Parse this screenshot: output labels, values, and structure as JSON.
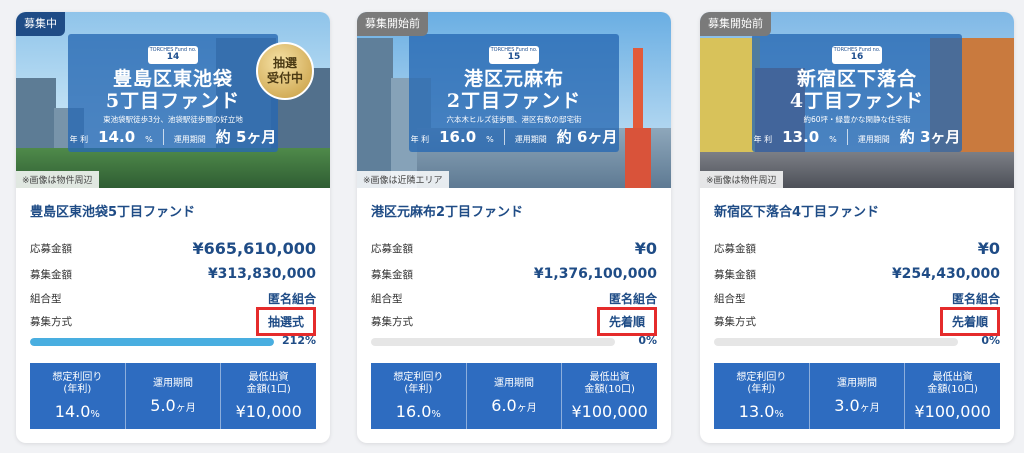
{
  "cards": [
    {
      "status": "募集中",
      "photo_note": "※画像は物件周辺",
      "lottery_badge_line1": "抽選",
      "lottery_badge_line2": "受付中",
      "hero": {
        "fund_label": "TORCHES Fund no.",
        "fund_no": "14",
        "title_line1": "豊島区東池袋",
        "title_line2": "5丁目ファンド",
        "subtitle": "東池袋駅徒歩3分、池袋駅徒歩圏の好立地",
        "yield_label": "年 利",
        "yield_value": "14.0",
        "period_label": "運用期間",
        "period_value": "約 5ヶ月"
      },
      "title": "豊島区東池袋5丁目ファンド",
      "rows": {
        "applied_label": "応募金額",
        "applied_value": "¥665,610,000",
        "target_label": "募集金額",
        "target_value": "¥313,830,000",
        "type_label": "組合型",
        "type_value": "匿名組合",
        "method_label": "募集方式",
        "method_value": "抽選式"
      },
      "progress_percent": "212%",
      "progress_fraction": 1.0,
      "stats": [
        {
          "label": "想定利回り\n(年利)",
          "value": "14.0",
          "unit": "%"
        },
        {
          "label": "運用期間",
          "value": "5.0",
          "unit": "ヶ月"
        },
        {
          "label": "最低出資\n金額(1口)",
          "value": "¥10,000",
          "unit": ""
        }
      ]
    },
    {
      "status": "募集開始前",
      "photo_note": "※画像は近隣エリア",
      "hero": {
        "fund_label": "TORCHES Fund no.",
        "fund_no": "15",
        "title_line1": "港区元麻布",
        "title_line2": "2丁目ファンド",
        "subtitle": "六本木ヒルズ徒歩圏、港区有数の邸宅街",
        "yield_label": "年 利",
        "yield_value": "16.0",
        "period_label": "運用期間",
        "period_value": "約 6ヶ月"
      },
      "title": "港区元麻布2丁目ファンド",
      "rows": {
        "applied_label": "応募金額",
        "applied_value": "¥0",
        "target_label": "募集金額",
        "target_value": "¥1,376,100,000",
        "type_label": "組合型",
        "type_value": "匿名組合",
        "method_label": "募集方式",
        "method_value": "先着順"
      },
      "progress_percent": "0%",
      "progress_fraction": 0,
      "stats": [
        {
          "label": "想定利回り\n(年利)",
          "value": "16.0",
          "unit": "%"
        },
        {
          "label": "運用期間",
          "value": "6.0",
          "unit": "ヶ月"
        },
        {
          "label": "最低出資\n金額(10口)",
          "value": "¥100,000",
          "unit": ""
        }
      ]
    },
    {
      "status": "募集開始前",
      "photo_note": "※画像は物件周辺",
      "hero": {
        "fund_label": "TORCHES Fund no.",
        "fund_no": "16",
        "title_line1": "新宿区下落合",
        "title_line2": "4丁目ファンド",
        "subtitle": "約60坪・緑豊かな閑静な住宅街",
        "yield_label": "年 利",
        "yield_value": "13.0",
        "period_label": "運用期間",
        "period_value": "約 3ヶ月"
      },
      "title": "新宿区下落合4丁目ファンド",
      "rows": {
        "applied_label": "応募金額",
        "applied_value": "¥0",
        "target_label": "募集金額",
        "target_value": "¥254,430,000",
        "type_label": "組合型",
        "type_value": "匿名組合",
        "method_label": "募集方式",
        "method_value": "先着順"
      },
      "progress_percent": "0%",
      "progress_fraction": 0,
      "stats": [
        {
          "label": "想定利回り\n(年利)",
          "value": "13.0",
          "unit": "%"
        },
        {
          "label": "運用期間",
          "value": "3.0",
          "unit": "ヶ月"
        },
        {
          "label": "最低出資\n金額(10口)",
          "value": "¥100,000",
          "unit": ""
        }
      ]
    }
  ],
  "colors": {
    "brand": "#1f4c86",
    "stats_bg": "#2e6cc0",
    "progress": "#49aee0",
    "highlight": "#e52b2b"
  }
}
